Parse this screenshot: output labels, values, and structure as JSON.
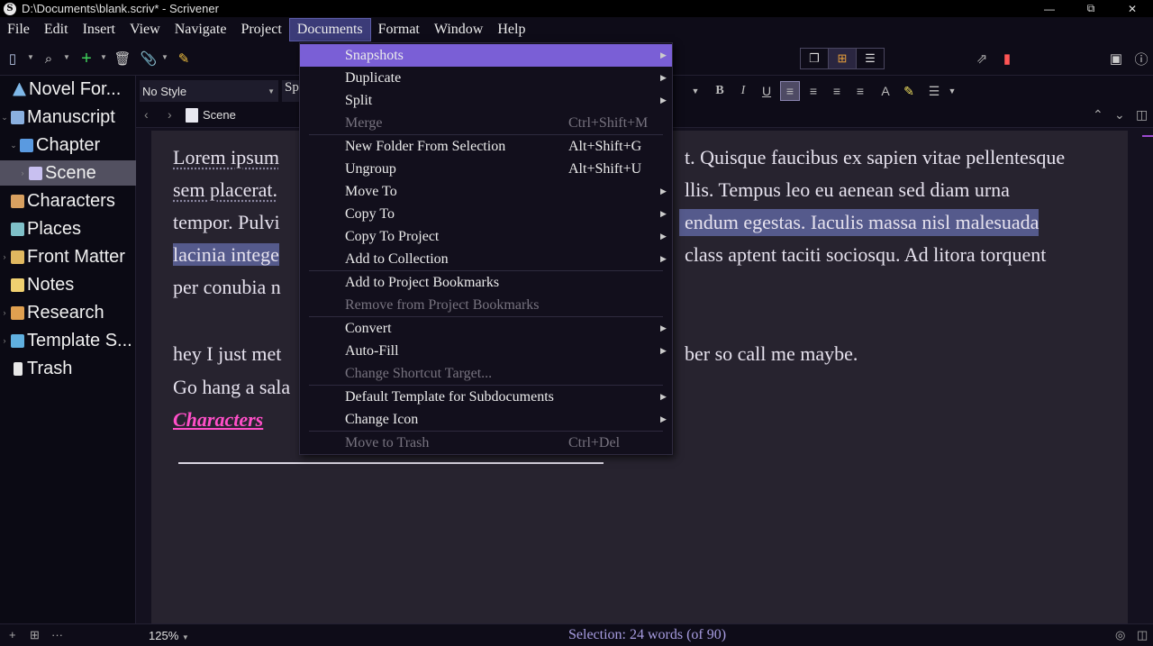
{
  "window": {
    "title": "D:\\Documents\\blank.scriv* - Scrivener",
    "app_icon": "S",
    "minimize": "—",
    "restore": "⧉",
    "close": "✕"
  },
  "menubar": [
    "File",
    "Edit",
    "Insert",
    "View",
    "Navigate",
    "Project",
    "Documents",
    "Format",
    "Window",
    "Help"
  ],
  "binder": [
    {
      "label": "Novel For...",
      "icon_color": "#7fb8e8",
      "disc": "",
      "indent": 0
    },
    {
      "label": "Manuscript",
      "icon_color": "#8ab0e0",
      "disc": "⌄",
      "indent": 0
    },
    {
      "label": "Chapter",
      "icon_color": "#5a9ae0",
      "disc": "⌄",
      "indent": 1
    },
    {
      "label": "Scene",
      "icon_color": "#c8c0f0",
      "disc": "›",
      "indent": 2
    },
    {
      "label": "Characters",
      "icon_color": "#d8a060",
      "disc": "",
      "indent": 0
    },
    {
      "label": "Places",
      "icon_color": "#7fc0c8",
      "disc": "",
      "indent": 0
    },
    {
      "label": "Front Matter",
      "icon_color": "#e0b860",
      "disc": "›",
      "indent": 0
    },
    {
      "label": "Notes",
      "icon_color": "#f0d070",
      "disc": "",
      "indent": 0
    },
    {
      "label": "Research",
      "icon_color": "#e0a050",
      "disc": "›",
      "indent": 0
    },
    {
      "label": "Template S...",
      "icon_color": "#60b0e0",
      "disc": "›",
      "indent": 0
    },
    {
      "label": "Trash",
      "icon_color": "#e8e8e8",
      "disc": "",
      "indent": 0
    }
  ],
  "formatbar": {
    "style": "No Style",
    "font": "Sp"
  },
  "navbar": {
    "doc": "Scene"
  },
  "editor": {
    "line1_a": "Lorem ipsum",
    "line1_b": "t. Quisque faucibus ex sapien vitae pellentesque",
    "line2_a": "sem placerat.",
    "line2_b": "llis. Tempus leo eu aenean sed diam urna",
    "line3_a": "tempor. Pulvi",
    "line3_b": "endum egestas. Iaculis massa nisl malesuada",
    "line4_a": "lacinia intege",
    "line4_b": "class aptent taciti sociosqu. Ad litora torquent",
    "line5_a": "per conubia n",
    "line6_a": "hey I just met",
    "line6_b": "ber so call me maybe.",
    "line7_a": "Go hang a sala",
    "link": "Characters"
  },
  "footer": {
    "zoom": "125%",
    "selection": "Selection: 24 words (of 90)"
  },
  "documents_menu": [
    {
      "label": "Snapshots",
      "shortcut": "",
      "submenu": true,
      "state": "highlighted"
    },
    {
      "label": "Duplicate",
      "shortcut": "",
      "submenu": true,
      "state": "normal"
    },
    {
      "label": "Split",
      "shortcut": "",
      "submenu": true,
      "state": "normal"
    },
    {
      "label": "Merge",
      "shortcut": "Ctrl+Shift+M",
      "submenu": false,
      "state": "disabled"
    },
    {
      "label": "New Folder From Selection",
      "shortcut": "Alt+Shift+G",
      "submenu": false,
      "state": "normal"
    },
    {
      "label": "Ungroup",
      "shortcut": "Alt+Shift+U",
      "submenu": false,
      "state": "normal"
    },
    {
      "label": "Move To",
      "shortcut": "",
      "submenu": true,
      "state": "normal"
    },
    {
      "label": "Copy To",
      "shortcut": "",
      "submenu": true,
      "state": "normal"
    },
    {
      "label": "Copy To Project",
      "shortcut": "",
      "submenu": true,
      "state": "normal"
    },
    {
      "label": "Add to Collection",
      "shortcut": "",
      "submenu": true,
      "state": "normal"
    },
    {
      "label": "Add to Project Bookmarks",
      "shortcut": "",
      "submenu": false,
      "state": "normal"
    },
    {
      "label": "Remove from Project Bookmarks",
      "shortcut": "",
      "submenu": false,
      "state": "disabled"
    },
    {
      "label": "Convert",
      "shortcut": "",
      "submenu": true,
      "state": "normal"
    },
    {
      "label": "Auto-Fill",
      "shortcut": "",
      "submenu": true,
      "state": "normal"
    },
    {
      "label": "Change Shortcut Target...",
      "shortcut": "",
      "submenu": false,
      "state": "disabled"
    },
    {
      "label": "Default Template for Subdocuments",
      "shortcut": "",
      "submenu": true,
      "state": "normal"
    },
    {
      "label": "Change Icon",
      "shortcut": "",
      "submenu": true,
      "state": "normal"
    },
    {
      "label": "Move to Trash",
      "shortcut": "Ctrl+Del",
      "submenu": false,
      "state": "disabled"
    }
  ],
  "colors": {
    "accent": "#7a5fd6",
    "link": "#ff4fc8",
    "selection_highlight": "#555a8c"
  }
}
